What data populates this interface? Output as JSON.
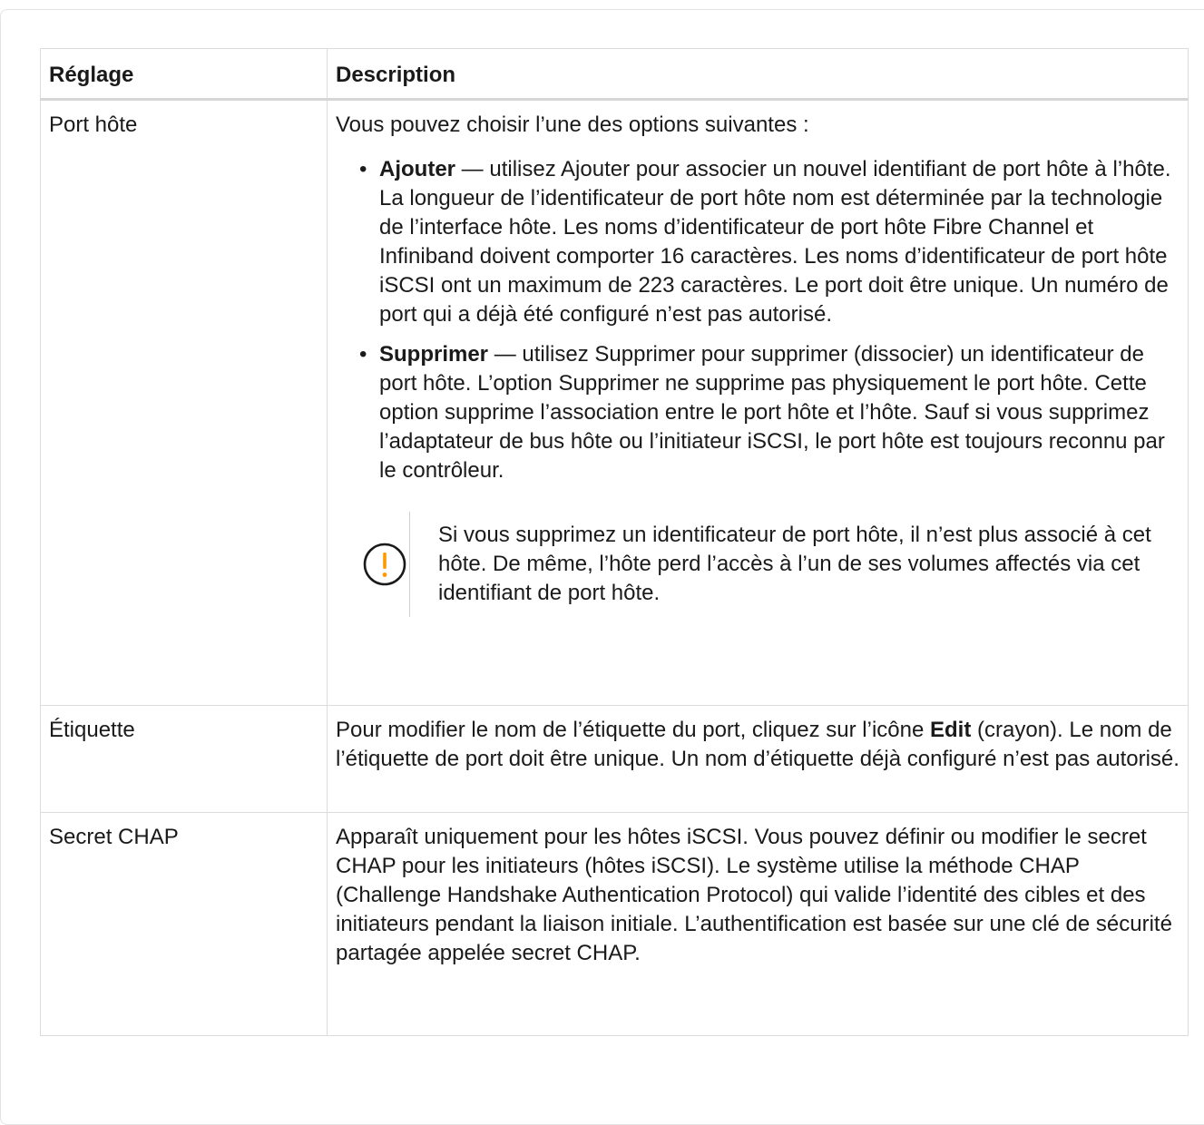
{
  "table": {
    "headers": {
      "setting": "Réglage",
      "description": "Description"
    },
    "rows": [
      {
        "setting": "Port hôte",
        "intro": "Vous pouvez choisir l’une des options suivantes :",
        "options": [
          {
            "term": "Ajouter",
            "dash": " — ",
            "text": "utilisez Ajouter pour associer un nouvel identifiant de port hôte à l’hôte. La longueur de l’identificateur de port hôte nom est déterminée par la technologie de l’interface hôte. Les noms d’identificateur de port hôte Fibre Channel et Infiniband doivent comporter 16 caractères. Les noms d’identificateur de port hôte iSCSI ont un maximum de 223 caractères. Le port doit être unique. Un numéro de port qui a déjà été configuré n’est pas autorisé."
          },
          {
            "term": "Supprimer",
            "dash": " — ",
            "text": "utilisez Supprimer pour supprimer (dissocier) un identificateur de port hôte. L’option Supprimer ne supprime pas physiquement le port hôte. Cette option supprime l’association entre le port hôte et l’hôte. Sauf si vous supprimez l’adaptateur de bus hôte ou l’initiateur iSCSI, le port hôte est toujours reconnu par le contrôleur."
          }
        ],
        "note": {
          "icon": "warning-circle-icon",
          "icon_color": "#ff9900",
          "text": "Si vous supprimez un identificateur de port hôte, il n’est plus associé à cet hôte. De même, l’hôte perd l’accès à l’un de ses volumes affectés via cet identifiant de port hôte."
        }
      },
      {
        "setting": "Étiquette",
        "text_before": "Pour modifier le nom de l’étiquette du port, cliquez sur l’icône ",
        "bold": "Edit",
        "text_after": " (crayon). Le nom de l’étiquette de port doit être unique. Un nom d’étiquette déjà configuré n’est pas autorisé."
      },
      {
        "setting": "Secret CHAP",
        "text": "Apparaît uniquement pour les hôtes iSCSI. Vous pouvez définir ou modifier le secret CHAP pour les initiateurs (hôtes iSCSI). Le système utilise la méthode CHAP (Challenge Handshake Authentication Protocol) qui valide l’identité des cibles et des initiateurs pendant la liaison initiale. L’authentification est basée sur une clé de sécurité partagée appelée secret CHAP."
      }
    ]
  }
}
